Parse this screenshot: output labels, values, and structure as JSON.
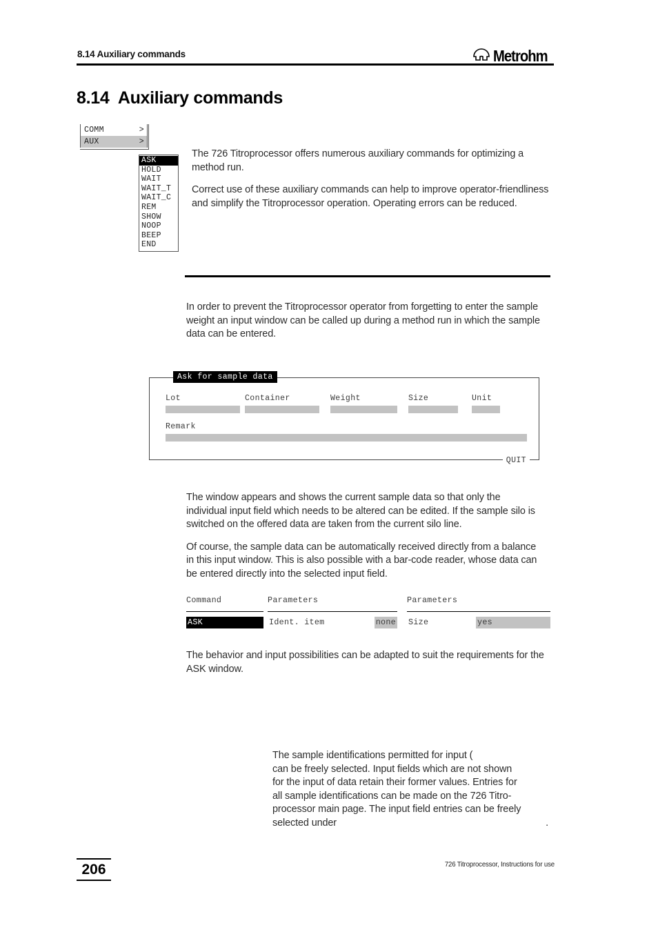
{
  "header": {
    "running_title": "8.14 Auxiliary commands",
    "logo_text": "Metrohm",
    "logo_icon": "metrohm-omega-arch-icon"
  },
  "section": {
    "heading": "8.14  Auxiliary commands"
  },
  "menu": {
    "top_items": [
      {
        "label": "COMM",
        "chevron": ">",
        "selected": false
      },
      {
        "label": "AUX",
        "chevron": ">",
        "selected": true
      }
    ],
    "submenu_items": [
      {
        "label": "ASK",
        "highlighted": true
      },
      {
        "label": "HOLD",
        "highlighted": false
      },
      {
        "label": "WAIT",
        "highlighted": false
      },
      {
        "label": "WAIT_T",
        "highlighted": false
      },
      {
        "label": "WAIT_C",
        "highlighted": false
      },
      {
        "label": "REM",
        "highlighted": false
      },
      {
        "label": "SHOW",
        "highlighted": false
      },
      {
        "label": "NOOP",
        "highlighted": false
      },
      {
        "label": "BEEP",
        "highlighted": false
      },
      {
        "label": "END",
        "highlighted": false
      }
    ]
  },
  "body": {
    "intro_p1": "The 726 Titroprocessor offers numerous auxiliary commands for optimizing a method run.",
    "intro_p2": "Correct use of these auxiliary commands can help to improve operator-friendliness and simplify the Titroprocessor operation. Operating errors can be reduced.",
    "ask_intro": "In order to prevent the Titroprocessor operator from forgetting to enter the sample weight an input window can be called up during a method run in which the sample data can be entered.",
    "window_desc_p1": "The window appears and shows the current sample data so that only the individual input field which needs to be altered can be edited. If the sample silo is switched on the offered data are taken from the current silo line.",
    "window_desc_p2": "Of course, the sample data can be automatically received directly from a balance in this input window. This is also possible with a bar-code reader, whose data can be entered directly into the selected input field.",
    "behavior_note": "The behavior and input possibilities can be adapted to suit the requirements for the ASK window.",
    "ident_note_line1": "The sample identifications permitted for input (",
    "ident_note_line2": "can be freely selected. Input fields which are not shown",
    "ident_note_line3": "for the input of data retain their former values. Entries for",
    "ident_note_line4": "all sample identifications can be made on the 726 Titro-",
    "ident_note_line5": "processor main page. The input field entries can be freely",
    "ident_note_line6": "selected under",
    "ident_note_trailing": "."
  },
  "dialog": {
    "title": "Ask for sample data",
    "quit_label": "QUIT",
    "fields": [
      {
        "label": "Lot",
        "value": ""
      },
      {
        "label": "Container",
        "value": ""
      },
      {
        "label": "Weight",
        "value": ""
      },
      {
        "label": "Size",
        "value": ""
      },
      {
        "label": "Unit",
        "value": ""
      }
    ],
    "remark": {
      "label": "Remark",
      "value": ""
    }
  },
  "command_table": {
    "headers": [
      "Command",
      "Parameters",
      "Parameters"
    ],
    "row": {
      "command": "ASK",
      "param1_name": "Ident. item",
      "param1_value": "none",
      "param2_name": "Size",
      "param2_value": "yes"
    }
  },
  "footer": {
    "page_number": "206",
    "document_title": "726 Titroprocessor, Instructions for use"
  }
}
